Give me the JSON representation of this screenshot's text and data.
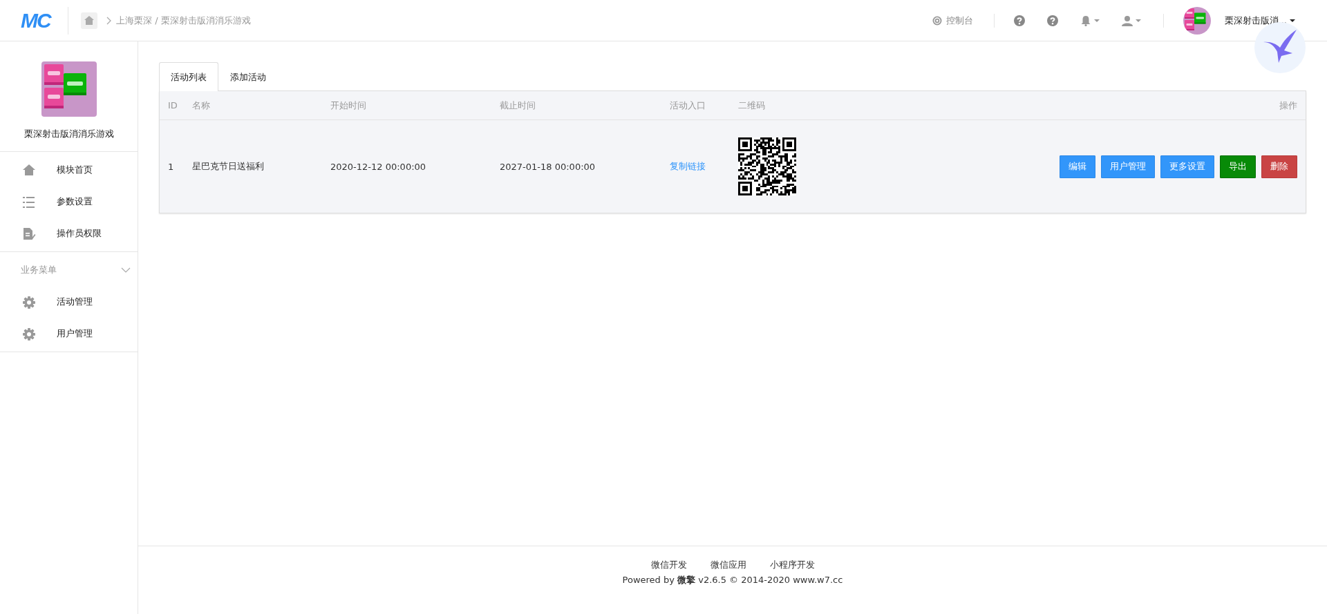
{
  "header": {
    "logo": "MC",
    "breadcrumb": "上海栗深 / 栗深射击版消消乐游戏",
    "console": "控制台",
    "user_name": "栗深射击版消..."
  },
  "sidebar": {
    "app_name": "栗深射击版消消乐游戏",
    "items": [
      {
        "label": "模块首页",
        "kind": "home"
      },
      {
        "label": "参数设置",
        "kind": "list"
      },
      {
        "label": "操作员权限",
        "kind": "doc"
      }
    ],
    "section": {
      "title": "业务菜单",
      "expanded": true,
      "items": [
        {
          "label": "活动管理",
          "kind": "gear"
        },
        {
          "label": "用户管理",
          "kind": "gear"
        }
      ]
    }
  },
  "tabs": [
    {
      "label": "活动列表",
      "selected": true
    },
    {
      "label": "添加活动",
      "selected": false
    }
  ],
  "table": {
    "columns": [
      "ID",
      "名称",
      "开始时间",
      "截止时间",
      "活动入口",
      "二维码",
      "操作"
    ],
    "rows": [
      {
        "id": "1",
        "name": "星巴克节日送福利",
        "start": "2020-12-12 00:00:00",
        "end": "2027-01-18 00:00:00",
        "entry": "复制链接",
        "actions": [
          {
            "label": "编辑",
            "kind": "primary"
          },
          {
            "label": "用户管理",
            "kind": "primary"
          },
          {
            "label": "更多设置",
            "kind": "primary"
          },
          {
            "label": "导出",
            "kind": "success"
          },
          {
            "label": "删除",
            "kind": "danger"
          }
        ]
      }
    ]
  },
  "footer": {
    "links": [
      "微信开发",
      "微信应用",
      "小程序开发"
    ],
    "powered": "Powered by **微擎** v2.6.5 © 2014-2020 www.w7.cc"
  }
}
